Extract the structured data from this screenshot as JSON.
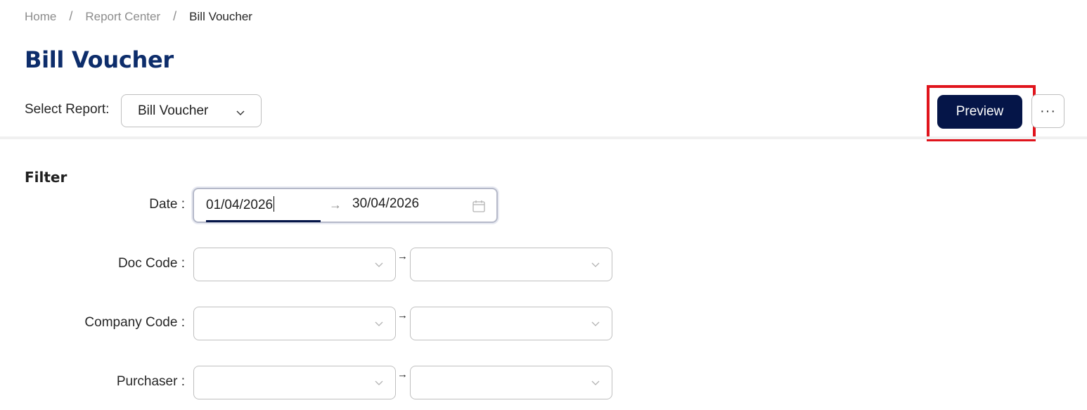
{
  "breadcrumb": {
    "items": [
      "Home",
      "Report Center",
      "Bill Voucher"
    ],
    "separator": "/"
  },
  "page": {
    "title": "Bill Voucher"
  },
  "report_select": {
    "label": "Select Report:",
    "value": "Bill Voucher"
  },
  "toolbar": {
    "preview_label": "Preview",
    "more_label": "···"
  },
  "filter": {
    "title": "Filter",
    "date": {
      "label": "Date :",
      "start": "01/04/2026",
      "end": "30/04/2026",
      "arrow": "→"
    },
    "fields": [
      {
        "label": "Doc Code :",
        "from": "",
        "to": ""
      },
      {
        "label": "Company Code :",
        "from": "",
        "to": ""
      },
      {
        "label": "Purchaser :",
        "from": "",
        "to": ""
      }
    ],
    "range_arrow": "→"
  },
  "colors": {
    "title": "#0d2d6b",
    "primary_button": "#051548",
    "highlight": "#e0141c"
  },
  "icons": [
    "chevron-down-icon",
    "calendar-icon",
    "more-icon"
  ]
}
